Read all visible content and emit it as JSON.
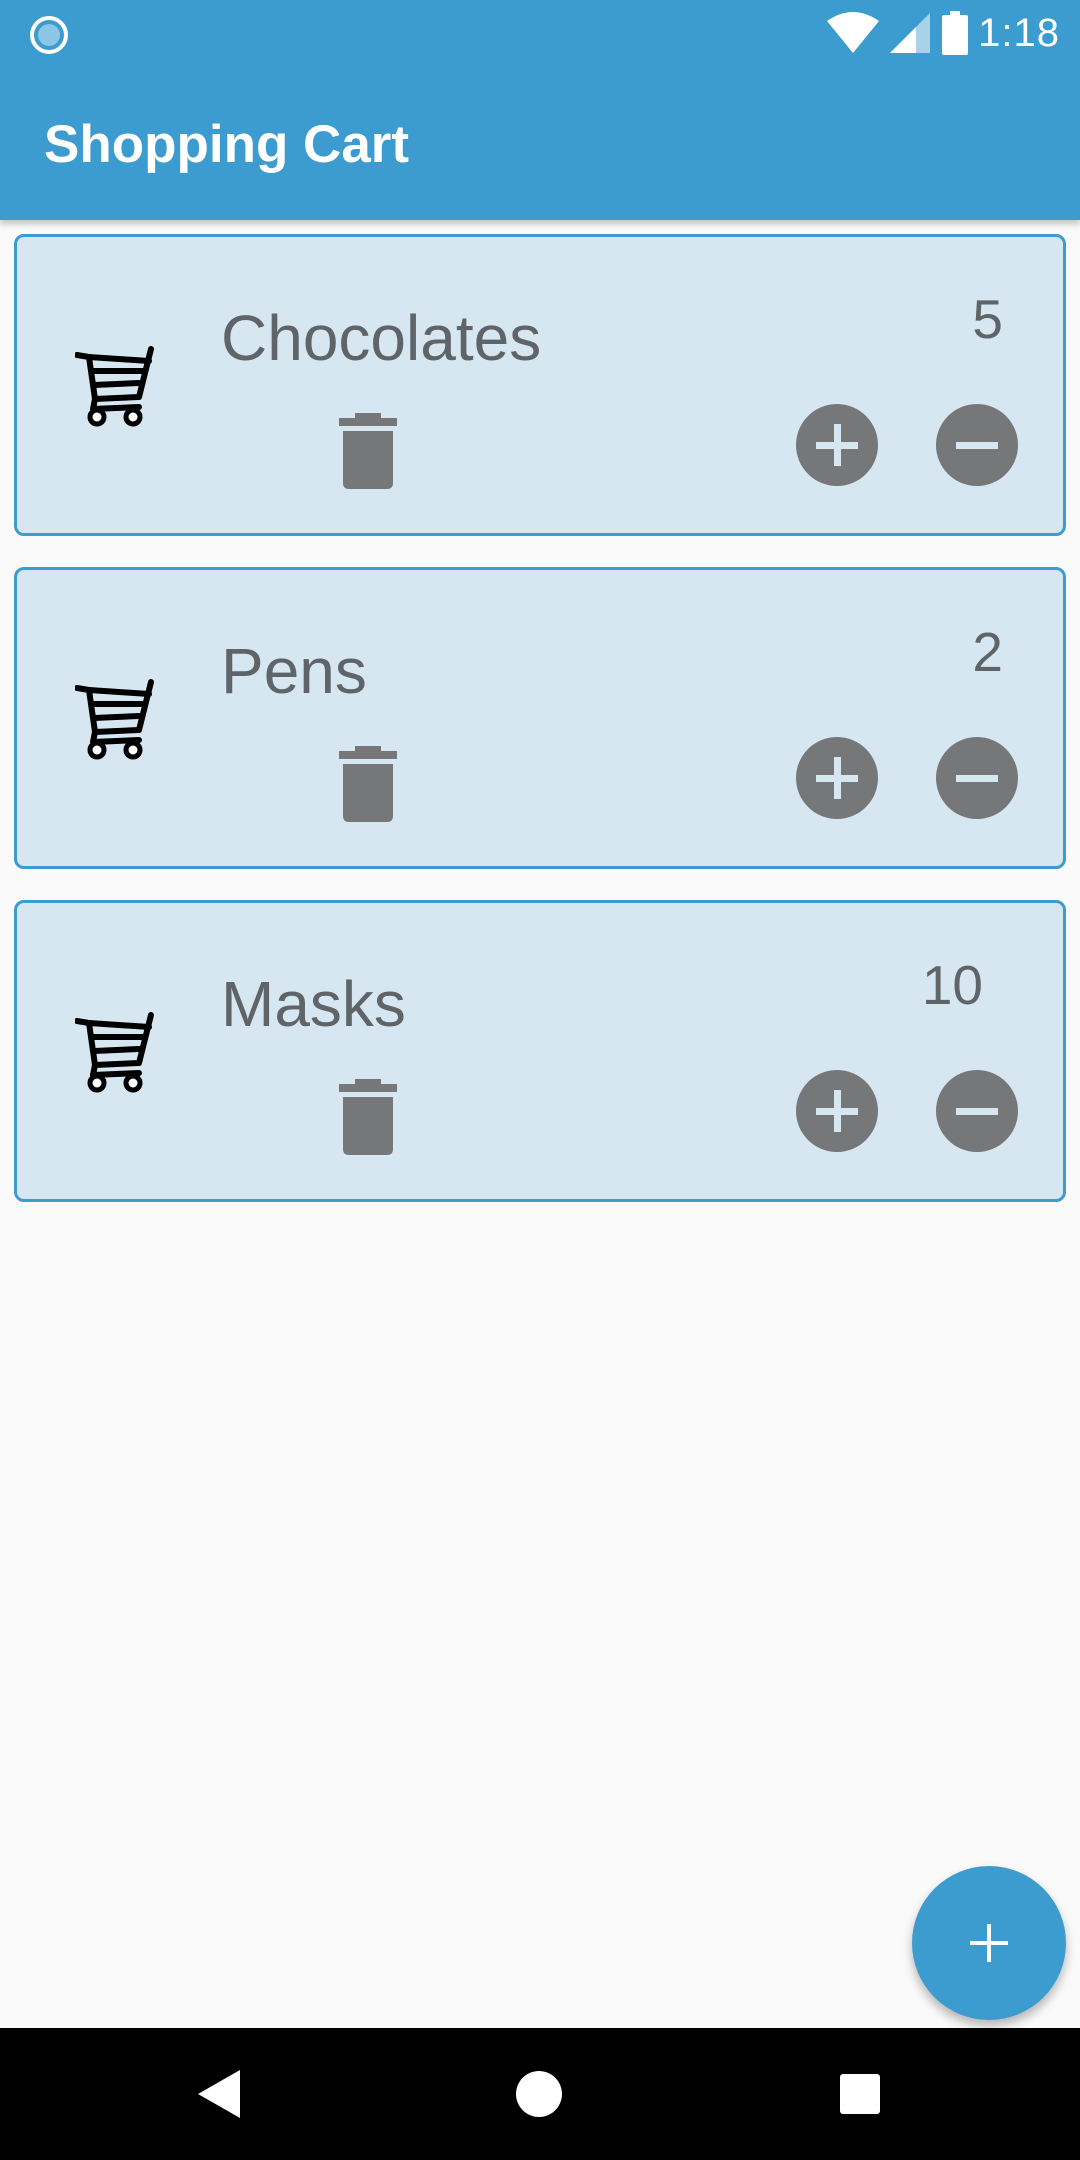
{
  "status_bar": {
    "time": "1:18",
    "icons": [
      "notification-circle-icon",
      "wifi-icon",
      "cell-signal-icon",
      "battery-icon"
    ]
  },
  "app_bar": {
    "title": "Shopping Cart"
  },
  "items": [
    {
      "name": "Chocolates",
      "quantity": "5"
    },
    {
      "name": "Pens",
      "quantity": "2"
    },
    {
      "name": "Masks",
      "quantity": "10"
    }
  ],
  "colors": {
    "primary": "#3d9ccf",
    "card_background": "#d6e7f1",
    "card_border": "#3d9ccf",
    "text": "#5f6468",
    "control_gray": "#757779",
    "background": "#fafafa"
  },
  "fab": {
    "icon": "plus-icon"
  },
  "nav_bar": {
    "icons": [
      "back-icon",
      "home-icon",
      "recents-icon"
    ]
  }
}
